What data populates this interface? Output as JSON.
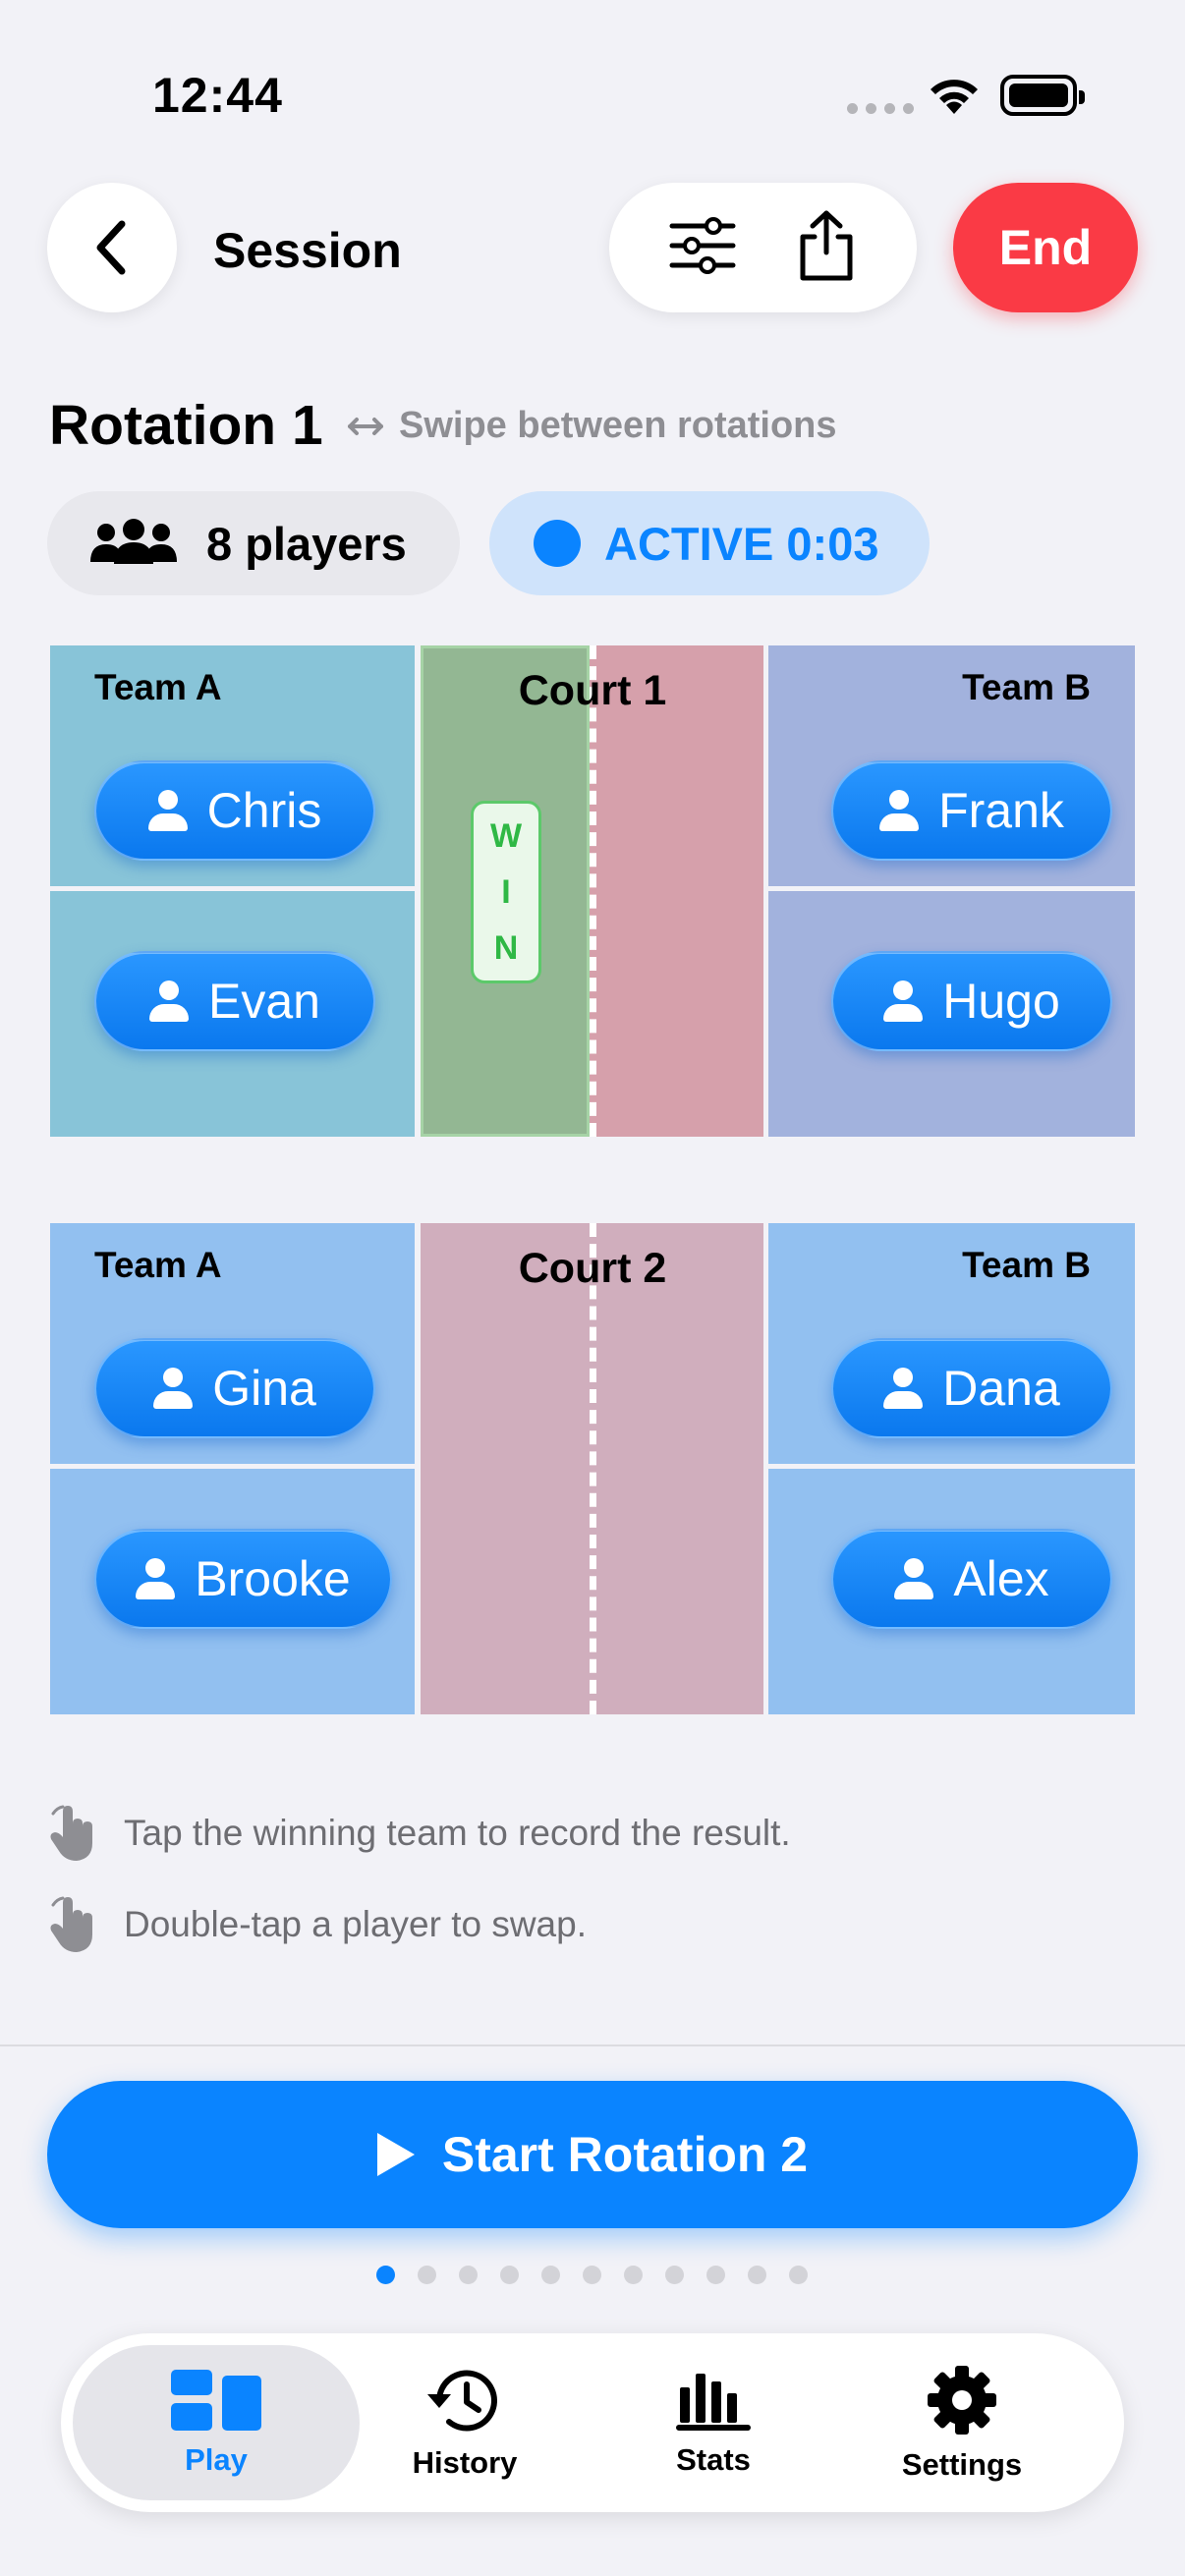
{
  "status": {
    "time": "12:44"
  },
  "header": {
    "title": "Session",
    "end_label": "End"
  },
  "rotation": {
    "title": "Rotation 1",
    "swipe_hint": "Swipe between rotations",
    "players_label": "8 players",
    "status_label": "ACTIVE 0:03"
  },
  "courts": [
    {
      "name": "Court 1",
      "team_a_label": "Team A",
      "team_b_label": "Team B",
      "team_a": [
        "Chris",
        "Evan"
      ],
      "team_b": [
        "Frank",
        "Hugo"
      ],
      "win_badge": [
        "W",
        "I",
        "N"
      ]
    },
    {
      "name": "Court 2",
      "team_a_label": "Team A",
      "team_b_label": "Team B",
      "team_a": [
        "Gina",
        "Brooke"
      ],
      "team_b": [
        "Dana",
        "Alex"
      ]
    }
  ],
  "hints": [
    "Tap the winning team to record the result.",
    "Double-tap a player to swap."
  ],
  "start_button": "Start Rotation 2",
  "pager": {
    "count": 11,
    "current": 1
  },
  "tabs": [
    {
      "label": "Play",
      "icon": "play-tab-icon",
      "selected": true
    },
    {
      "label": "History",
      "icon": "history-icon",
      "selected": false
    },
    {
      "label": "Stats",
      "icon": "stats-icon",
      "selected": false
    },
    {
      "label": "Settings",
      "icon": "gear-icon",
      "selected": false
    }
  ],
  "colors": {
    "accent": "#0a84ff",
    "end": "#fa3a45",
    "win": "#2fb845",
    "court1_team_a": "#88c4d8",
    "court1_team_b": "#a2b2dd",
    "court1_kitchen_left": "#93b793",
    "court1_kitchen_right": "#d6a0ab",
    "court2_side": "#92c0f0",
    "court2_kitchen": "#d0aebd"
  }
}
